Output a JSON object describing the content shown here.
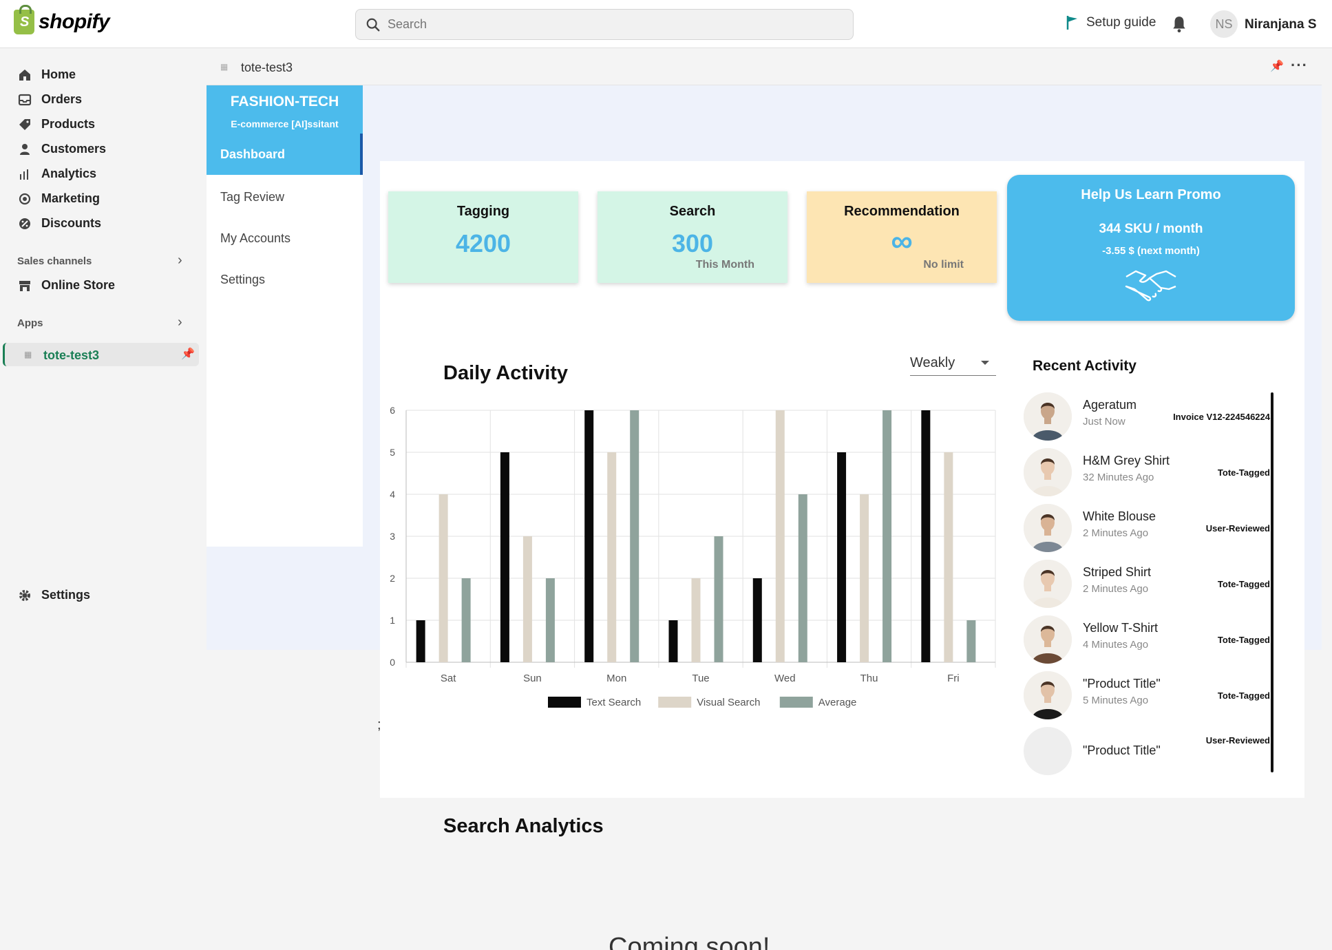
{
  "topbar": {
    "brand": "shopify",
    "search_placeholder": "Search",
    "setup_guide": "Setup guide",
    "avatar_initials": "NS",
    "user_name": "Niranjana S"
  },
  "nav": {
    "items": [
      "Home",
      "Orders",
      "Products",
      "Customers",
      "Analytics",
      "Marketing",
      "Discounts"
    ],
    "sales_channels": "Sales channels",
    "online_store": "Online Store",
    "apps": "Apps",
    "app_name": "tote-test3",
    "settings": "Settings"
  },
  "app_header": {
    "title": "tote-test3"
  },
  "app_sidebar": {
    "brand": "FASHION-TECH",
    "subtitle": "E-commerce [AI]ssitant",
    "active": "Dashboard",
    "links": [
      "Tag Review",
      "My Accounts",
      "Settings"
    ]
  },
  "cards": [
    {
      "title": "Tagging",
      "value": "4200",
      "sub": "",
      "bg": "#d4f5e6"
    },
    {
      "title": "Search",
      "value": "300",
      "sub": "This Month",
      "bg": "#d4f5e6"
    },
    {
      "title": "Recommendation",
      "value": "∞",
      "sub": "No limit",
      "bg": "#fde5b3"
    }
  ],
  "promo": {
    "title": "Help Us Learn Promo",
    "sku": "344 SKU / month",
    "price": "-3.55 $ (next month)"
  },
  "daily_activity": {
    "title": "Daily Activity",
    "period": "Weakly"
  },
  "chart_data": {
    "type": "bar",
    "categories": [
      "Sat",
      "Sun",
      "Mon",
      "Tue",
      "Wed",
      "Thu",
      "Fri"
    ],
    "series": [
      {
        "name": "Text Search",
        "color": "#0a0a0a",
        "values": [
          1,
          5,
          6,
          1,
          2,
          5,
          6
        ]
      },
      {
        "name": "Visual Search",
        "color": "#ddd5c8",
        "values": [
          4,
          3,
          5,
          2,
          6,
          4,
          5
        ]
      },
      {
        "name": "Average",
        "color": "#8fa39c",
        "values": [
          2,
          2,
          6,
          3,
          4,
          6,
          1
        ]
      }
    ],
    "yticks": [
      0,
      1,
      2,
      3,
      4,
      5,
      6
    ],
    "ylim": [
      0,
      6
    ],
    "grid": true,
    "legend": "bottom"
  },
  "recent": {
    "title": "Recent Activity",
    "items": [
      {
        "name": "Ageratum",
        "time": "Just Now",
        "tag": "Invoice V12-224546224",
        "skin": "#c9a68a",
        "cloth": "#4a5a6a"
      },
      {
        "name": "H&M Grey Shirt",
        "time": "32 Minutes Ago",
        "tag": "Tote-Tagged",
        "skin": "#e8c9b0",
        "cloth": "#efe9e0"
      },
      {
        "name": "White Blouse",
        "time": "2 Minutes Ago",
        "tag": "User-Reviewed",
        "skin": "#d9b395",
        "cloth": "#7d8894"
      },
      {
        "name": "Striped Shirt",
        "time": "2 Minutes Ago",
        "tag": "Tote-Tagged",
        "skin": "#e8c9b0",
        "cloth": "#efe9e0"
      },
      {
        "name": "Yellow T-Shirt",
        "time": "4 Minutes Ago",
        "tag": "Tote-Tagged",
        "skin": "#dcb899",
        "cloth": "#6b4a36"
      },
      {
        "name": "\"Product Title\"",
        "time": "5 Minutes Ago",
        "tag": "Tote-Tagged",
        "skin": "#e2c2a8",
        "cloth": "#1a1a1a"
      },
      {
        "name": "\"Product Title\"",
        "time": "",
        "tag": "User-Reviewed",
        "skin": "",
        "cloth": ""
      }
    ]
  },
  "search_analytics": {
    "title": "Search Analytics",
    "coming_soon": "Coming soon!"
  }
}
